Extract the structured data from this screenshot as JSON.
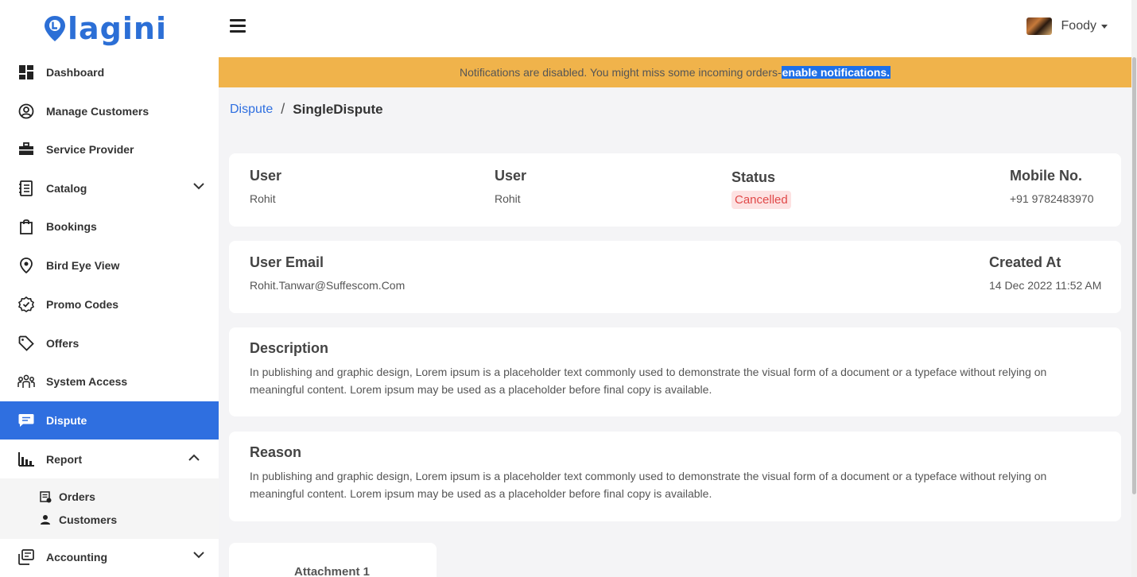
{
  "brand": {
    "name": "lagini"
  },
  "sidebar": {
    "items": [
      {
        "label": "Dashboard",
        "icon": "dashboard-icon"
      },
      {
        "label": "Manage Customers",
        "icon": "user-circle-icon"
      },
      {
        "label": "Service Provider",
        "icon": "briefcase-icon"
      },
      {
        "label": "Catalog",
        "icon": "catalog-icon",
        "chevron": "down"
      },
      {
        "label": "Bookings",
        "icon": "shopping-bag-icon"
      },
      {
        "label": "Bird Eye View",
        "icon": "location-pin-icon"
      },
      {
        "label": "Promo Codes",
        "icon": "badge-check-icon"
      },
      {
        "label": "Offers",
        "icon": "tag-icon"
      },
      {
        "label": "System Access",
        "icon": "group-icon"
      },
      {
        "label": "Dispute",
        "icon": "chat-icon",
        "active": true
      },
      {
        "label": "Report",
        "icon": "bar-chart-icon",
        "chevron": "up"
      },
      {
        "label": "Accounting",
        "icon": "accounting-icon",
        "chevron": "down"
      }
    ],
    "report_sub": [
      {
        "label": "Orders",
        "icon": "orders-icon"
      },
      {
        "label": "Customers",
        "icon": "person-icon"
      }
    ]
  },
  "header": {
    "user_name": "Foody"
  },
  "notification": {
    "text": "Notifications are disabled. You might miss some incoming orders-",
    "link": "enable notifications.",
    "color": "#f0b34b"
  },
  "breadcrumb": {
    "parent": "Dispute",
    "separator": "/",
    "current": "SingleDispute"
  },
  "dispute": {
    "user1_label": "User",
    "user1_value": "Rohit",
    "user2_label": "User",
    "user2_value": "Rohit",
    "status_label": "Status",
    "status_value": "Cancelled",
    "mobile_label": "Mobile No.",
    "mobile_value": "+91 9782483970",
    "email_label": "User Email",
    "email_value": "Rohit.Tanwar@Suffescom.Com",
    "created_label": "Created At",
    "created_value": "14 Dec 2022 11:52 AM",
    "description_label": "Description",
    "description_text": "In publishing and graphic design, Lorem ipsum is a placeholder text commonly used to demonstrate the visual form of a document or a typeface without relying on meaningful content. Lorem ipsum may be used as a placeholder before final copy is available.",
    "reason_label": "Reason",
    "reason_text": "In publishing and graphic design, Lorem ipsum is a placeholder text commonly used to demonstrate the visual form of a document or a typeface without relying on meaningful content. Lorem ipsum may be used as a placeholder before final copy is available.",
    "attachment_label": "Attachment 1"
  },
  "colors": {
    "accent": "#2f6fe0",
    "status_cancelled": "#e04848",
    "status_cancelled_bg": "#fde2e2"
  }
}
